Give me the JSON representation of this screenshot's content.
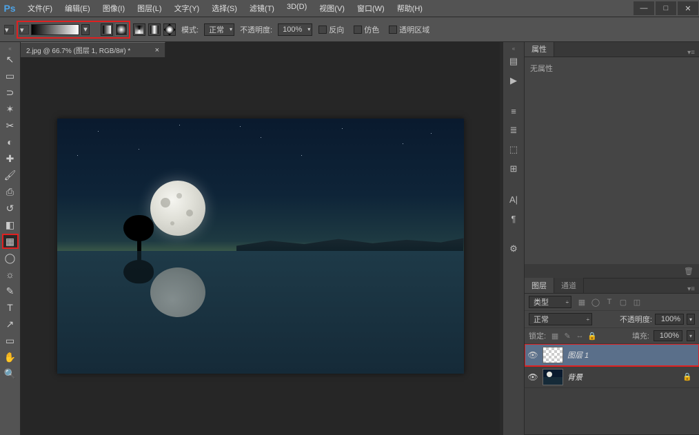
{
  "app_logo": "Ps",
  "menu": [
    "文件(F)",
    "编辑(E)",
    "图像(I)",
    "图层(L)",
    "文字(Y)",
    "选择(S)",
    "滤镜(T)",
    "3D(D)",
    "视图(V)",
    "窗口(W)",
    "帮助(H)"
  ],
  "win_controls": {
    "min": "—",
    "max": "□",
    "close": "✕"
  },
  "options": {
    "mode_label": "模式:",
    "mode_value": "正常",
    "opacity_label": "不透明度:",
    "opacity_value": "100%",
    "reverse_label": "反向",
    "dither_label": "仿色",
    "transparency_label": "透明区域"
  },
  "doc_tab": "2.jpg @ 66.7% (图层 1, RGB/8#) *",
  "doc_tab_close": "×",
  "right": {
    "props_tab": "属性",
    "props_body": "无属性",
    "layers_tab": "图层",
    "channels_tab": "通道",
    "kind_label": "类型",
    "blend_value": "正常",
    "opacity_label": "不透明度:",
    "opacity_value": "100%",
    "lock_label": "锁定:",
    "fill_label": "填充:",
    "fill_value": "100%"
  },
  "layers": [
    {
      "name": "图层 1",
      "visible": true,
      "selected": true,
      "highlight": true,
      "thumb": "trans",
      "locked": false
    },
    {
      "name": "背景",
      "visible": true,
      "selected": false,
      "highlight": false,
      "thumb": "img",
      "locked": true
    }
  ],
  "tool_icons": {
    "move": "↖",
    "marquee": "▭",
    "lasso": "⊃",
    "wand": "✶",
    "crop": "✂",
    "eyedrop": "◐",
    "heal": "✚",
    "brush": "🖌",
    "stamp": "⎙",
    "history": "↺",
    "eraser": "◧",
    "gradient": "▦",
    "blur": "◯",
    "dodge": "☼",
    "pen": "✎",
    "type": "T",
    "path": "↗",
    "shape": "▭",
    "hand": "✋",
    "zoom": "🔍"
  },
  "dock_icons": [
    "▤",
    "▶",
    "",
    "≡",
    "≣",
    "⬚",
    "⊞",
    "",
    "A|",
    "¶",
    "",
    "⚙"
  ],
  "layer_type_icons": [
    "▦",
    "◯",
    "T",
    "▢",
    "◫"
  ],
  "lock_type_icons": [
    "▦",
    "✎",
    "↔",
    "🔒"
  ],
  "trash_icon": "🗑",
  "eye_icon": "👁",
  "panel_menu": "▾≡",
  "collapse": "«"
}
